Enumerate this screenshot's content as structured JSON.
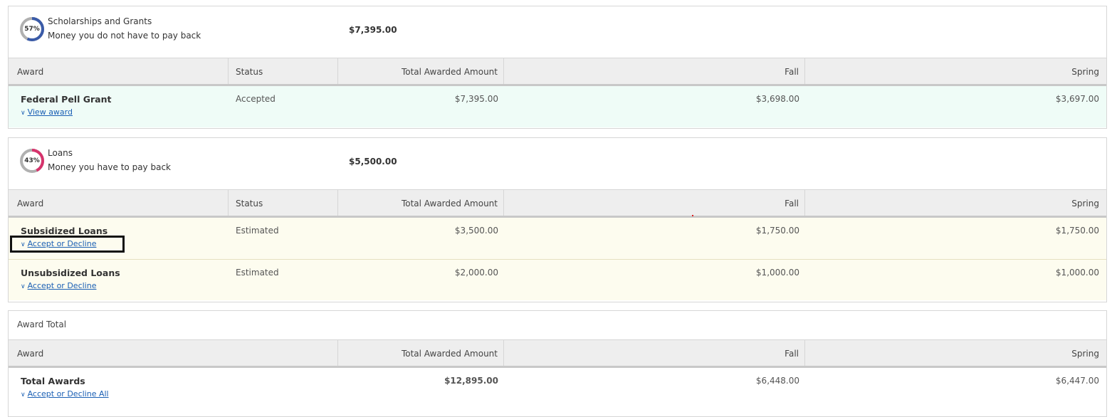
{
  "colors": {
    "accent_link": "#1a5fb4",
    "grants_donut": "#3a5ba8",
    "loans_donut": "#d6336c",
    "donut_track": "#b0b0b0",
    "row_green": "#effcf7",
    "row_yellow": "#fdfcef"
  },
  "columns": {
    "award": "Award",
    "status": "Status",
    "total": "Total Awarded Amount",
    "fall": "Fall",
    "spring": "Spring"
  },
  "grants": {
    "percent_label": "57%",
    "percent_value": 0.57,
    "title": "Scholarships and Grants",
    "subtitle": "Money you do not have to pay back",
    "amount": "$7,395.00",
    "rows": [
      {
        "name": "Federal Pell Grant",
        "link": "View award",
        "status": "Accepted",
        "total": "$7,395.00",
        "fall": "$3,698.00",
        "spring": "$3,697.00"
      }
    ]
  },
  "loans": {
    "percent_label": "43%",
    "percent_value": 0.43,
    "title": "Loans",
    "subtitle": "Money you have to pay back",
    "amount": "$5,500.00",
    "rows": [
      {
        "name": "Subsidized Loans",
        "link": "Accept or Decline",
        "status": "Estimated",
        "total": "$3,500.00",
        "fall": "$1,750.00",
        "spring": "$1,750.00"
      },
      {
        "name": "Unsubsidized Loans",
        "link": "Accept or Decline",
        "status": "Estimated",
        "total": "$2,000.00",
        "fall": "$1,000.00",
        "spring": "$1,000.00"
      }
    ]
  },
  "totals": {
    "title": "Award Total",
    "name": "Total Awards",
    "link": "Accept or Decline All",
    "total": "$12,895.00",
    "fall": "$6,448.00",
    "spring": "$6,447.00"
  },
  "icons": {
    "chevron": "chevron-down-icon"
  }
}
